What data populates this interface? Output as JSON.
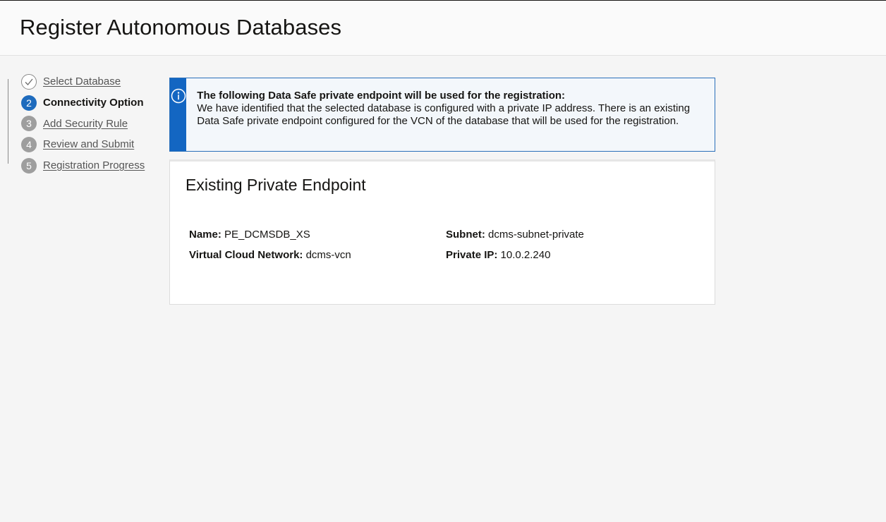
{
  "page": {
    "title": "Register Autonomous Databases"
  },
  "steps": [
    {
      "number": "",
      "label": "Select Database",
      "state": "done",
      "icon": "check-icon"
    },
    {
      "number": "2",
      "label": "Connectivity Option",
      "state": "current"
    },
    {
      "number": "3",
      "label": "Add Security Rule",
      "state": "pending"
    },
    {
      "number": "4",
      "label": "Review and Submit",
      "state": "pending"
    },
    {
      "number": "5",
      "label": "Registration Progress",
      "state": "pending"
    }
  ],
  "banner": {
    "icon": "info-icon",
    "title": "The following Data Safe private endpoint will be used for the registration:",
    "body": "We have identified that the selected database is configured with a private IP address. There is an existing Data Safe private endpoint configured for the VCN of the database that will be used for the registration."
  },
  "endpoint": {
    "heading": "Existing Private Endpoint",
    "name_label": "Name:",
    "name_value": "PE_DCMSDB_XS",
    "vcn_label": "Virtual Cloud Network:",
    "vcn_value": "dcms-vcn",
    "subnet_label": "Subnet:",
    "subnet_value": "dcms-subnet-private",
    "ip_label": "Private IP:",
    "ip_value": "10.0.2.240"
  },
  "colors": {
    "accent": "#1366c2",
    "pending_step": "#9e9e9e"
  }
}
